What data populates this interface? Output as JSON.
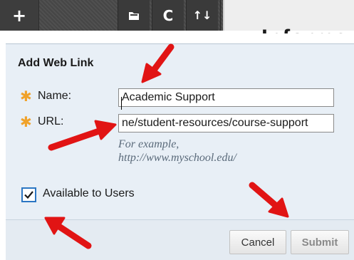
{
  "toolbar": {
    "add_icon": "plus-icon",
    "folder_icon": "folder-icon",
    "refresh_icon": "refresh-icon",
    "sort_icon": "sort-icon",
    "add_glyph": "+",
    "refresh_glyph": "C",
    "sort_glyph": "↑↓"
  },
  "page": {
    "heading": "Informa"
  },
  "form": {
    "title": "Add Web Link",
    "required_glyph": "✱",
    "name_label": "Name:",
    "name_value": "Academic Support",
    "url_label": "URL:",
    "url_value": "ne/student-resources/course-support",
    "hint_line1": "For example,",
    "hint_line2": "http://www.myschool.edu/",
    "available_label": "Available to Users",
    "available_checked": true
  },
  "buttons": {
    "cancel": "Cancel",
    "submit": "Submit"
  },
  "colors": {
    "toolbar": "#4a4a4a",
    "panel": "#e8eff6",
    "required": "#f0a22a",
    "checkbox_border": "#2b76c3",
    "annotation_arrow": "#e11414"
  }
}
